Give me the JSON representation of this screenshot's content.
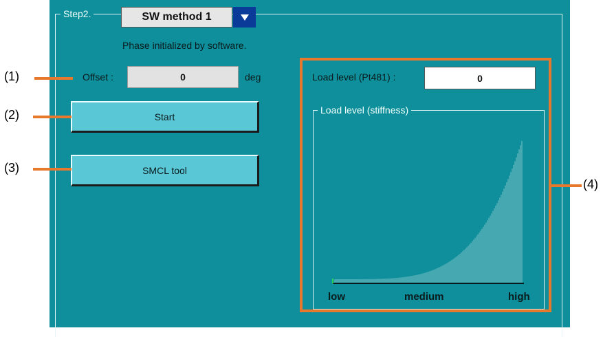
{
  "step": {
    "label": "Step2."
  },
  "method_select": {
    "value": "SW method 1",
    "icon": "dropdown-arrow-icon"
  },
  "note": "Phase initialized by software.",
  "offset": {
    "label": "Offset :",
    "value": "0",
    "unit": "deg"
  },
  "buttons": {
    "start": "Start",
    "smcl": "SMCL tool"
  },
  "load": {
    "label": "Load level (Pt481) :",
    "value": "0",
    "group_title": "Load level (stiffness)",
    "axis": {
      "low": "low",
      "medium": "medium",
      "high": "high"
    },
    "level": 0
  },
  "callouts": {
    "c1": "(1)",
    "c2": "(2)",
    "c3": "(3)",
    "c4": "(4)"
  },
  "colors": {
    "panel": "#0e8f9b",
    "button": "#5ac7d6",
    "callout": "#e8792c",
    "dropdown": "#0b3b99"
  }
}
